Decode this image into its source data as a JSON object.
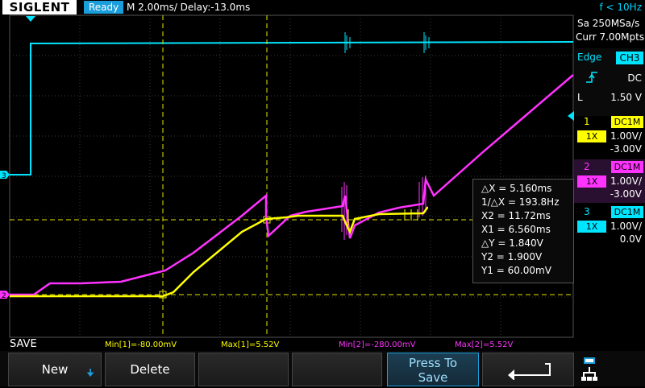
{
  "header": {
    "brand": "SIGLENT",
    "status": "Ready",
    "timebase": "M 2.00ms/ Delay:-13.0ms",
    "frequency": "f < 10Hz"
  },
  "acquisition": {
    "sample_rate": "Sa 250MSa/s",
    "memory_depth": "Curr 7.00Mpts"
  },
  "trigger": {
    "type": "Edge",
    "source": "CH3",
    "coupling": "DC",
    "level_label": "L",
    "level": "1.50 V"
  },
  "channels": [
    {
      "num": "1",
      "coupling": "DC1M",
      "probe": "1X",
      "scale": "1.00V/",
      "offset": "-3.00V",
      "color": "#ffff00"
    },
    {
      "num": "2",
      "coupling": "DC1M",
      "probe": "1X",
      "scale": "1.00V/",
      "offset": "-3.00V",
      "color": "#ff33ff"
    },
    {
      "num": "3",
      "coupling": "DC1M",
      "probe": "1X",
      "scale": "1.00V/",
      "offset": "0.0V",
      "color": "#00e5ff"
    }
  ],
  "cursors": {
    "dx": "△X = 5.160ms",
    "inv_dx": "1/△X = 193.8Hz",
    "x2": "X2 = 11.72ms",
    "x1": "X1 = 6.560ms",
    "dy": "△Y = 1.840V",
    "y2": "Y2 = 1.900V",
    "y1": "Y1 = 60.00mV"
  },
  "channel_markers": {
    "ch3": "3",
    "ch12": "2"
  },
  "measurements": {
    "save_label": "SAVE",
    "min1": "Min[1]=-80.00mV",
    "max1": "Max[1]=5.52V",
    "min2": "Min[2]=-280.00mV",
    "max2": "Max[2]=5.52V"
  },
  "softkeys": {
    "new": "New",
    "delete": "Delete",
    "press_to_save_line1": "Press To",
    "press_to_save_line2": "Save"
  },
  "colors": {
    "ch1": "#ffff00",
    "ch2": "#ff33ff",
    "ch3": "#00e5ff",
    "accent": "#1a9edb",
    "grid": "#3a3a3a"
  }
}
